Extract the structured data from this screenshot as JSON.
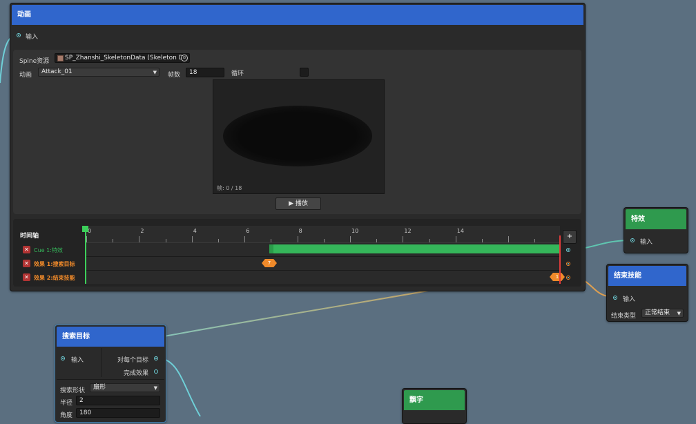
{
  "anim_node": {
    "title": "动画",
    "input_label": "输入",
    "spine_label": "Spine资源",
    "spine_value": "SP_Zhanshi_SkeletonData (Skeleton Da",
    "anim_label": "动画",
    "anim_value": "Attack_01",
    "frames_label": "帧数",
    "frames_value": "18",
    "loop_label": "循环",
    "frame_readout": "帧: 0 / 18",
    "play_label": "▶ 播放"
  },
  "timeline": {
    "title": "时间轴",
    "add_label": "+",
    "ticks": [
      "0",
      "2",
      "4",
      "6",
      "8",
      "10",
      "12",
      "14"
    ],
    "tracks": [
      {
        "label": "Cue 1:特效",
        "color": "#35b65a"
      },
      {
        "label": "效果 1:搜索目标",
        "color": "#f08a2a",
        "marker": "7"
      },
      {
        "label": "效果 2:结束技能",
        "color": "#f08a2a",
        "marker": "1"
      }
    ]
  },
  "effect_node": {
    "title": "特效",
    "input_label": "输入"
  },
  "end_node": {
    "title": "结束技能",
    "input_label": "输入",
    "type_label": "结束类型",
    "type_value": "正常结束"
  },
  "search_node": {
    "title": "搜索目标",
    "input_label": "输入",
    "each_target_label": "对每个目标",
    "done_label": "完成效果",
    "shape_label": "搜索形状",
    "shape_value": "扇形",
    "radius_label": "半径",
    "radius_value": "2",
    "angle_label": "角度",
    "angle_value": "180"
  },
  "float_node": {
    "title": "飘字"
  },
  "colors": {
    "canvas": "#5b6f80",
    "node_blue": "#3066cc",
    "node_green": "#2f9a4e",
    "wire_cyan": "#6fd0d8",
    "wire_orange": "#e5923a",
    "playhead": "#e03b3b",
    "cue_green": "#35b65a"
  }
}
